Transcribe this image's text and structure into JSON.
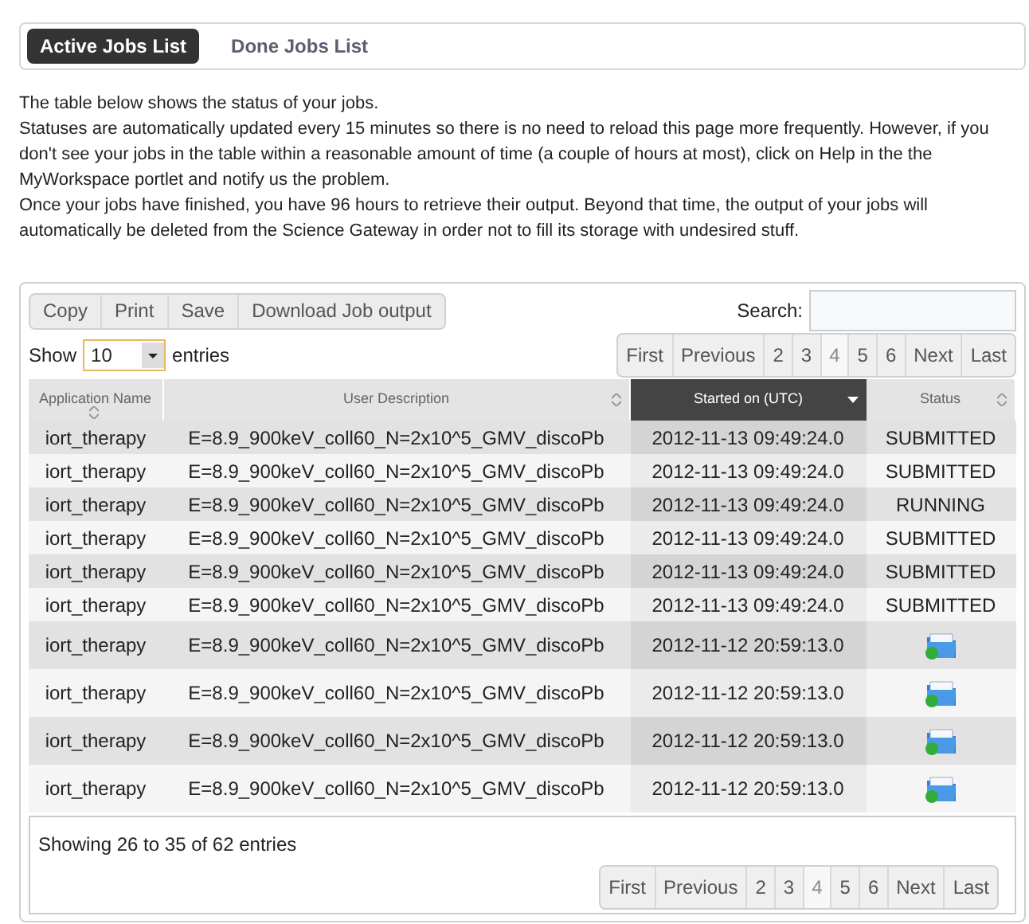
{
  "tabs": [
    {
      "label": "Active Jobs List",
      "selected": true
    },
    {
      "label": "Done Jobs List",
      "selected": false
    }
  ],
  "intro": [
    "The table below shows the status of your jobs.",
    "Statuses are automatically updated every 15 minutes so there is no need to reload this page more frequently. However, if you don't see your jobs in the table within a reasonable amount of time (a couple of hours at most), click on Help in the the MyWorkspace portlet and notify us the problem.",
    "Once your jobs have finished, you have 96 hours to retrieve their output. Beyond that time, the output of your jobs will automatically be deleted from the Science Gateway in order not to fill its storage with undesired stuff."
  ],
  "toolbar": [
    "Copy",
    "Print",
    "Save",
    "Download Job output"
  ],
  "search": {
    "label": "Search:"
  },
  "length": {
    "before": "Show",
    "value": "10",
    "after": "entries"
  },
  "pagination": [
    {
      "label": "First",
      "selected": false
    },
    {
      "label": "Previous",
      "selected": false
    },
    {
      "label": "2",
      "selected": false
    },
    {
      "label": "3",
      "selected": false
    },
    {
      "label": "4",
      "selected": true
    },
    {
      "label": "5",
      "selected": false
    },
    {
      "label": "6",
      "selected": false
    },
    {
      "label": "Next",
      "selected": false
    },
    {
      "label": "Last",
      "selected": false
    }
  ],
  "table": {
    "columns": [
      {
        "label": "Application Name",
        "sorted": false
      },
      {
        "label": "User Description",
        "sorted": false
      },
      {
        "label": "Started on (UTC)",
        "sorted": true
      },
      {
        "label": "Status",
        "sorted": false
      }
    ],
    "rows": [
      {
        "kind": "text",
        "app": "iort_therapy",
        "description": "E=8.9_900keV_coll60_N=2x10^5_GMV_discoPb",
        "started": "2012-11-13 09:49:24.0",
        "status": "SUBMITTED"
      },
      {
        "kind": "text",
        "app": "iort_therapy",
        "description": "E=8.9_900keV_coll60_N=2x10^5_GMV_discoPb",
        "started": "2012-11-13 09:49:24.0",
        "status": "SUBMITTED"
      },
      {
        "kind": "text",
        "app": "iort_therapy",
        "description": "E=8.9_900keV_coll60_N=2x10^5_GMV_discoPb",
        "started": "2012-11-13 09:49:24.0",
        "status": "RUNNING"
      },
      {
        "kind": "text",
        "app": "iort_therapy",
        "description": "E=8.9_900keV_coll60_N=2x10^5_GMV_discoPb",
        "started": "2012-11-13 09:49:24.0",
        "status": "SUBMITTED"
      },
      {
        "kind": "text",
        "app": "iort_therapy",
        "description": "E=8.9_900keV_coll60_N=2x10^5_GMV_discoPb",
        "started": "2012-11-13 09:49:24.0",
        "status": "SUBMITTED"
      },
      {
        "kind": "text",
        "app": "iort_therapy",
        "description": "E=8.9_900keV_coll60_N=2x10^5_GMV_discoPb",
        "started": "2012-11-13 09:49:24.0",
        "status": "SUBMITTED"
      },
      {
        "kind": "output",
        "app": "iort_therapy",
        "description": "E=8.9_900keV_coll60_N=2x10^5_GMV_discoPb",
        "started": "2012-11-12 20:59:13.0"
      },
      {
        "kind": "output",
        "app": "iort_therapy",
        "description": "E=8.9_900keV_coll60_N=2x10^5_GMV_discoPb",
        "started": "2012-11-12 20:59:13.0"
      },
      {
        "kind": "output",
        "app": "iort_therapy",
        "description": "E=8.9_900keV_coll60_N=2x10^5_GMV_discoPb",
        "started": "2012-11-12 20:59:13.0"
      },
      {
        "kind": "output",
        "app": "iort_therapy",
        "description": "E=8.9_900keV_coll60_N=2x10^5_GMV_discoPb",
        "started": "2012-11-12 20:59:13.0"
      }
    ]
  },
  "info": "Showing 26 to 35 of 62 entries",
  "bottom_pagination": [
    {
      "label": "First",
      "selected": false
    },
    {
      "label": "Previous",
      "selected": false
    },
    {
      "label": "2",
      "selected": false
    },
    {
      "label": "3",
      "selected": false
    },
    {
      "label": "4",
      "selected": true
    },
    {
      "label": "5",
      "selected": false
    },
    {
      "label": "6",
      "selected": false
    },
    {
      "label": "Next",
      "selected": false
    },
    {
      "label": "Last",
      "selected": false
    }
  ]
}
